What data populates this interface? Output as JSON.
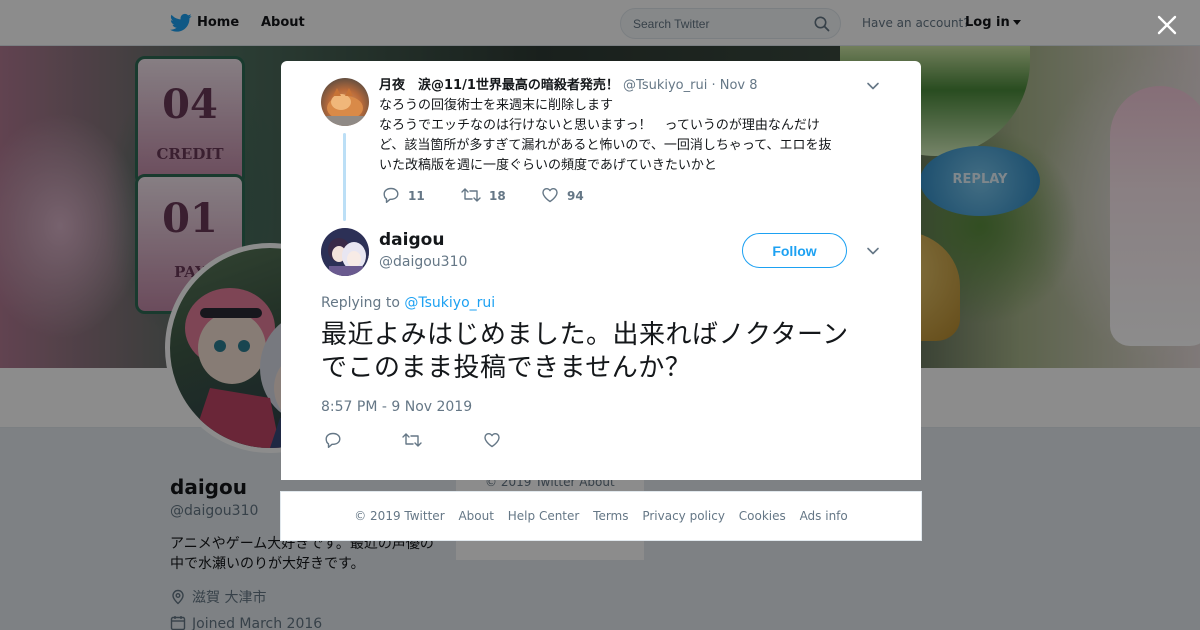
{
  "nav": {
    "home_label": "Home",
    "about_label": "About",
    "search_placeholder": "Search Twitter",
    "have_account": "Have an account?",
    "login_label": "Log in"
  },
  "profile": {
    "name": "daigou",
    "handle": "@daigou310",
    "bio": "アニメやゲーム大好きです。最近の声優の中で水瀬いのりが大好きです。",
    "location": "滋賀 大津市",
    "joined": "Joined March 2016",
    "side_footer": "© 2019 Twitter   About"
  },
  "banner": {
    "reel_top": "04",
    "reel_top_label": "CREDIT",
    "reel_mid": "01",
    "reel_mid_label": "PAY",
    "replay": "REPLAY"
  },
  "context_tweet": {
    "name": "月夜　涙@11/1世界最高の暗殺者発売！",
    "handle": "@Tsukiyo_rui",
    "separator": "·",
    "date": "Nov 8",
    "lines": [
      "なろうの回復術士を来週末に削除します",
      "なろうでエッチなのは行けないと思いますっ！　っていうのが理由なんだけ",
      "ど、該当箇所が多すぎて漏れがあると怖いので、一回消しちゃって、エロを抜",
      "いた改稿版を週に一度ぐらいの頻度であげていきたいかと"
    ],
    "replies": "11",
    "retweets": "18",
    "likes": "94"
  },
  "main_tweet": {
    "name": "daigou",
    "handle": "@daigou310",
    "follow_label": "Follow",
    "replying_prefix": "Replying to",
    "replying_to": "@Tsukiyo_rui",
    "text_line1": "最近よみはじめました。出来ればノクターン",
    "text_line2": "でこのまま投稿できませんか？",
    "timestamp": "8:57 PM - 9 Nov 2019"
  },
  "footer": {
    "copyright": "© 2019 Twitter",
    "about": "About",
    "help": "Help Center",
    "terms": "Terms",
    "privacy": "Privacy policy",
    "cookies": "Cookies",
    "ads": "Ads info"
  },
  "colors": {
    "brand": "#1da1f2",
    "text": "#14171a",
    "muted": "#657786",
    "thread_line": "#bcdff6"
  },
  "icons": {
    "logo": "twitter-bird-icon",
    "search": "search-icon",
    "close": "close-icon",
    "caret": "chevron-down-icon",
    "reply": "reply-icon",
    "retweet": "retweet-icon",
    "like": "heart-icon",
    "location": "location-pin-icon",
    "calendar": "calendar-icon"
  }
}
